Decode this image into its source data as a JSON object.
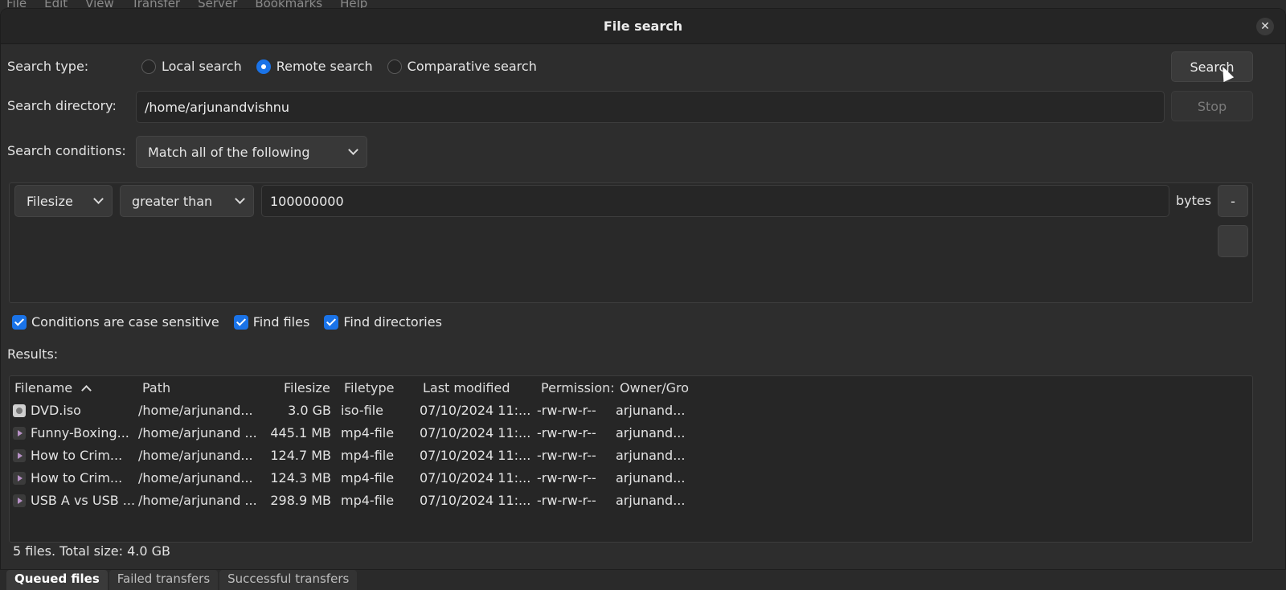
{
  "menubar": [
    "File",
    "Edit",
    "View",
    "Transfer",
    "Server",
    "Bookmarks",
    "Help"
  ],
  "dialog": {
    "title": "File search",
    "search_type_label": "Search type:",
    "search_types": [
      {
        "label": "Local search",
        "selected": false
      },
      {
        "label": "Remote search",
        "selected": true
      },
      {
        "label": "Comparative search",
        "selected": false
      }
    ],
    "search_button": "Search",
    "stop_button": "Stop",
    "directory_label": "Search directory:",
    "directory_value": "/home/arjunandvishnu",
    "conditions_label": "Search conditions:",
    "conditions_mode": "Match all of the following",
    "condition": {
      "field": "Filesize",
      "operator": "greater than",
      "value": "100000000",
      "unit": "bytes",
      "remove_label": "-"
    },
    "checkboxes": [
      {
        "label": "Conditions are case sensitive",
        "checked": true
      },
      {
        "label": "Find files",
        "checked": true
      },
      {
        "label": "Find directories",
        "checked": true
      }
    ],
    "results_label": "Results:",
    "columns": [
      "Filename",
      "Path",
      "Filesize",
      "Filetype",
      "Last modified",
      "Permission:",
      "Owner/Gro"
    ],
    "rows": [
      {
        "icon": "disc-icon",
        "name": "DVD.iso",
        "path": "/home/arjunand...",
        "size": "3.0 GB",
        "type": "iso-file",
        "modified": "07/10/2024 11:...",
        "perm": "-rw-rw-r--",
        "owner": "arjunand..."
      },
      {
        "icon": "video-icon",
        "name": "Funny-Boxing...",
        "path": "/home/arjunand ...",
        "size": "445.1 MB",
        "type": "mp4-file",
        "modified": "07/10/2024 11:...",
        "perm": "-rw-rw-r--",
        "owner": "arjunand..."
      },
      {
        "icon": "video-icon",
        "name": "How to Crim...",
        "path": "/home/arjunand...",
        "size": "124.7 MB",
        "type": "mp4-file",
        "modified": "07/10/2024 11:...",
        "perm": "-rw-rw-r--",
        "owner": "arjunand..."
      },
      {
        "icon": "video-icon",
        "name": "How to Crim...",
        "path": "/home/arjunand...",
        "size": "124.3 MB",
        "type": "mp4-file",
        "modified": "07/10/2024 11:...",
        "perm": "-rw-rw-r--",
        "owner": "arjunand..."
      },
      {
        "icon": "video-icon",
        "name": "USB A vs USB ...",
        "path": "/home/arjunand ...",
        "size": "298.9 MB",
        "type": "mp4-file",
        "modified": "07/10/2024 11:...",
        "perm": "-rw-rw-r--",
        "owner": "arjunand..."
      }
    ],
    "status": "5 files. Total size: 4.0 GB"
  },
  "bottom_tabs": [
    "Queued files",
    "Failed transfers",
    "Successful transfers"
  ],
  "colors": {
    "accent": "#1a73e8",
    "background": "#2d2d2d"
  }
}
